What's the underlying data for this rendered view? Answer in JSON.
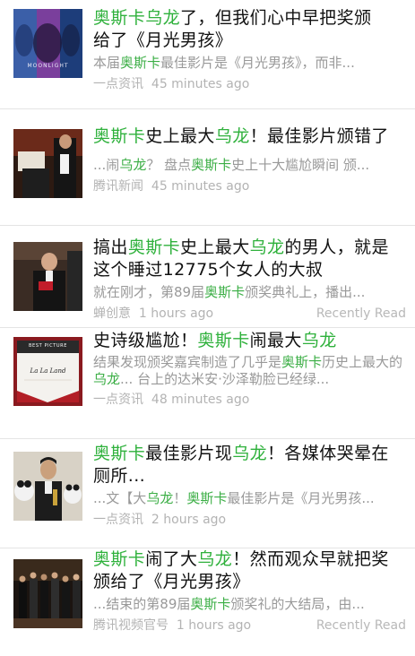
{
  "colors": {
    "highlight": "#2fb13c",
    "title": "#111111",
    "secondary": "#999999"
  },
  "items": [
    {
      "title": [
        {
          "t": "奥斯卡",
          "hl": true
        },
        {
          "t": "乌龙",
          "hl": true
        },
        {
          "t": "了，但我们心中早把奖颁"
        },
        {
          "t": "给了《月光男孩》"
        }
      ],
      "snippet": [
        {
          "t": "本届"
        },
        {
          "t": "奥斯卡",
          "hl": true
        },
        {
          "t": "最佳影片是《月光男孩》，而非..."
        }
      ],
      "source": "一点资讯",
      "time": "45 minutes ago",
      "read": "",
      "thumb_text": "MOONLIGHT"
    },
    {
      "title": [
        {
          "t": "奥斯卡",
          "hl": true
        },
        {
          "t": "史上最大"
        },
        {
          "t": "乌龙",
          "hl": true
        },
        {
          "t": "！最佳影片颁错了"
        }
      ],
      "snippet": [
        {
          "t": "...闹"
        },
        {
          "t": "乌龙",
          "hl": true
        },
        {
          "t": "？ 盘点"
        },
        {
          "t": "奥斯卡",
          "hl": true
        },
        {
          "t": "史上十大尴尬瞬间 颁..."
        }
      ],
      "source": "腾讯新闻",
      "time": "45 minutes ago",
      "read": "",
      "thumb_text": ""
    },
    {
      "title": [
        {
          "t": "搞出"
        },
        {
          "t": "奥斯卡",
          "hl": true
        },
        {
          "t": "史上最大"
        },
        {
          "t": "乌龙",
          "hl": true
        },
        {
          "t": "的男人，就是这个睡过12775个女人的大叔"
        }
      ],
      "snippet": [
        {
          "t": "就在刚才，第89届"
        },
        {
          "t": "奥斯卡",
          "hl": true
        },
        {
          "t": "颁奖典礼上，播出..."
        }
      ],
      "source": "蝉创意",
      "time": "1 hours ago",
      "read": "Recently Read",
      "thumb_text": ""
    },
    {
      "title": [
        {
          "t": "史诗级尴尬！"
        },
        {
          "t": "奥斯卡",
          "hl": true
        },
        {
          "t": "闹最大"
        },
        {
          "t": "乌龙",
          "hl": true
        }
      ],
      "snippet": [
        {
          "t": "结果发现颁奖嘉宾制造了几乎是"
        },
        {
          "t": "奥斯卡",
          "hl": true
        },
        {
          "t": "历史上最大的"
        },
        {
          "t": "乌龙",
          "hl": true
        },
        {
          "t": "... 台上的达米安·沙泽勒脸已经绿..."
        }
      ],
      "source": "一点资讯",
      "time": "48 minutes ago",
      "read": "",
      "thumb_text": "BEST PICTURE",
      "thumb_sub": "La La Land"
    },
    {
      "title": [
        {
          "t": "奥斯卡",
          "hl": true
        },
        {
          "t": "最佳影片现"
        },
        {
          "t": "乌龙",
          "hl": true
        },
        {
          "t": "！各媒体哭晕在厕所..."
        }
      ],
      "snippet": [
        {
          "t": "...文【大"
        },
        {
          "t": "乌龙",
          "hl": true
        },
        {
          "t": "！"
        },
        {
          "t": "奥斯卡",
          "hl": true
        },
        {
          "t": "最佳影片是《月光男孩..."
        }
      ],
      "source": "一点资讯",
      "time": "2 hours ago",
      "read": "",
      "thumb_text": ""
    },
    {
      "title": [
        {
          "t": "奥斯卡",
          "hl": true
        },
        {
          "t": "闹了大"
        },
        {
          "t": "乌龙",
          "hl": true
        },
        {
          "t": "！然而观众早就把奖颁给了《月光男孩》"
        }
      ],
      "snippet": [
        {
          "t": "...结束的第89届"
        },
        {
          "t": "奥斯卡",
          "hl": true
        },
        {
          "t": "颁奖礼的大结局，由..."
        }
      ],
      "source": "腾讯视频官号",
      "time": "1 hours ago",
      "read": "Recently Read",
      "thumb_text": ""
    }
  ]
}
